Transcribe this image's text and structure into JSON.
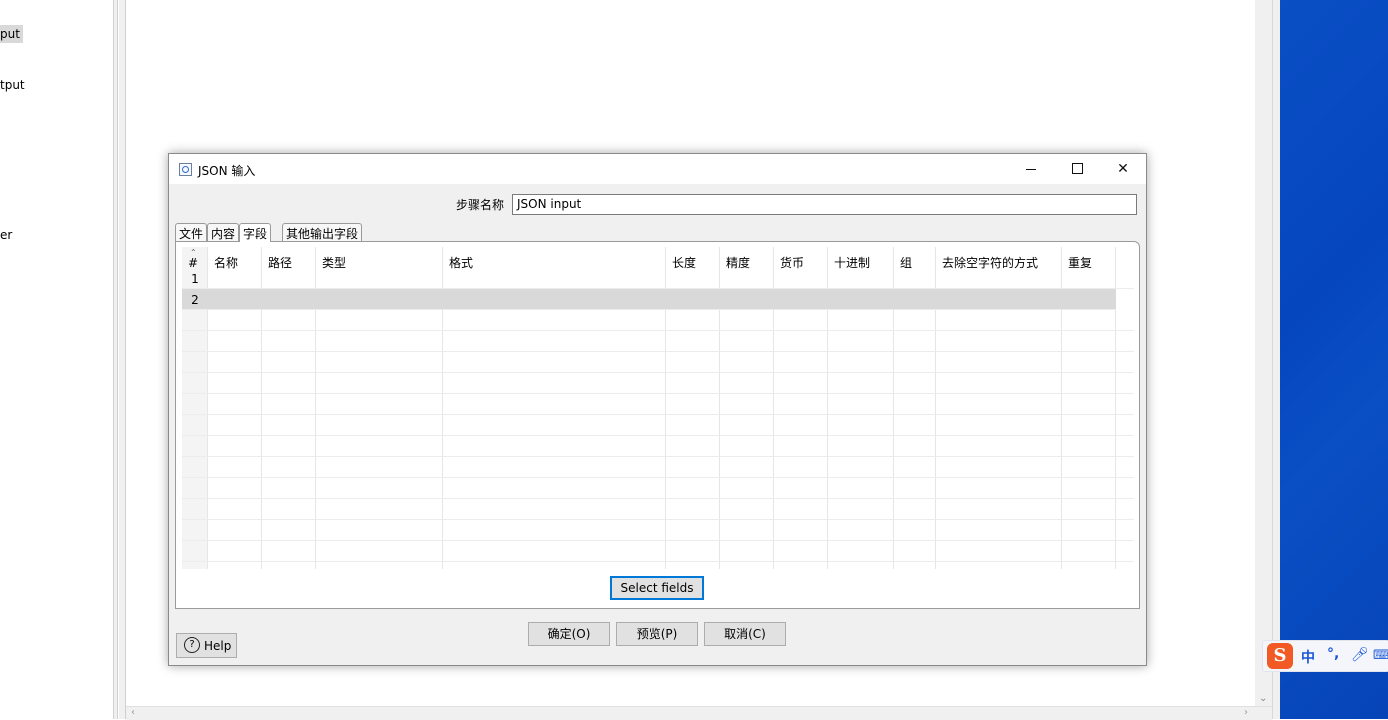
{
  "background": {
    "left_items": [
      "put",
      "tput",
      "er"
    ],
    "ime": {
      "logo": "S",
      "lang": "中",
      "punct": "°,",
      "mic_icon": "mic-icon",
      "keyboard_icon": "keyboard-icon"
    }
  },
  "dialog": {
    "title": "JSON 输入",
    "step_name_label": "步骤名称",
    "step_name_value": "JSON input",
    "tabs": [
      "文件",
      "内容",
      "字段",
      "其他输出字段"
    ],
    "active_tab": "字段",
    "grid": {
      "index_header": "#",
      "columns": [
        "名称",
        "路径",
        "类型",
        "格式",
        "长度",
        "精度",
        "货币",
        "十进制",
        "组",
        "去除空字符的方式",
        "重复"
      ],
      "rows": [
        "1",
        "2"
      ],
      "selected_row": "2"
    },
    "select_fields_label": "Select fields",
    "ok_label": "确定(O)",
    "preview_label": "预览(P)",
    "cancel_label": "取消(C)",
    "help_label": "Help"
  },
  "colors": {
    "dialog_bg": "#f0f0f0",
    "selected_row": "#d9d9d9",
    "focus_border": "#0078d7",
    "desktop": "#0a4fc4",
    "ime_logo": "#f15a24"
  }
}
